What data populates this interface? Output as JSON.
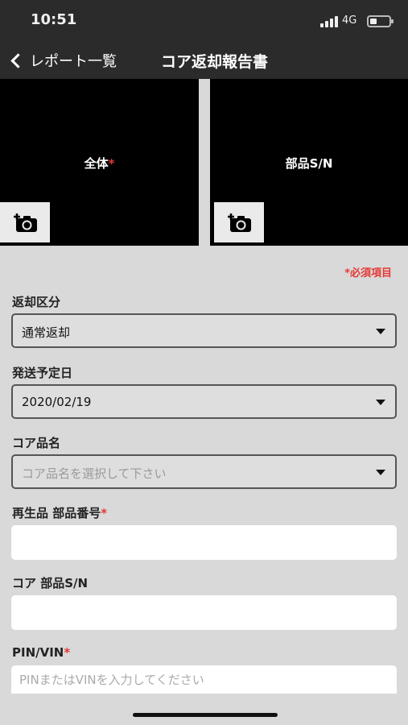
{
  "status": {
    "time": "10:51",
    "network": "4G"
  },
  "nav": {
    "back_label": "レポート一覧",
    "title": "コア返却報告書"
  },
  "photos": [
    {
      "label": "全体",
      "required": true,
      "icon": "add-camera-icon"
    },
    {
      "label": "部品S/N",
      "required": false,
      "icon": "add-camera-icon"
    }
  ],
  "form": {
    "required_note": "*必須項目",
    "return_type": {
      "label": "返却区分",
      "value": "通常返却"
    },
    "ship_date": {
      "label": "発送予定日",
      "value": "2020/02/19"
    },
    "core_name": {
      "label": "コア品名",
      "placeholder": "コア品名を選択して下さい"
    },
    "reman_part_no": {
      "label": "再生品 部品番号",
      "required_mark": "*",
      "value": ""
    },
    "core_part_sn": {
      "label": "コア 部品S/N",
      "value": ""
    },
    "pin_vin": {
      "label": "PIN/VIN",
      "required_mark": "*",
      "placeholder": "PINまたはVINを入力してください"
    }
  },
  "colors": {
    "header_bg": "#2b2b2b",
    "page_bg": "#d9d9d9",
    "required_red": "#e53935"
  }
}
